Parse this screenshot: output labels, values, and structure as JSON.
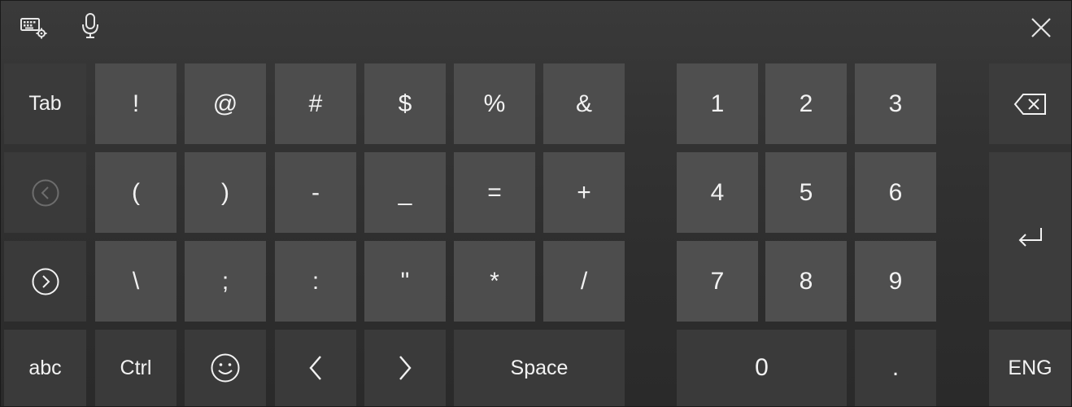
{
  "toolbar": {
    "settings_icon": "keyboard-settings-icon",
    "mic_icon": "microphone-icon",
    "close_icon": "close-icon"
  },
  "left_column": {
    "tab_label": "Tab",
    "back_icon": "circle-chevron-left-icon",
    "forward_icon": "circle-chevron-right-icon",
    "abc_label": "abc"
  },
  "symbols": {
    "row1": [
      "!",
      "@",
      "#",
      "$",
      "%",
      "&"
    ],
    "row2": [
      "(",
      ")",
      "-",
      "_",
      "=",
      "+"
    ],
    "row3": [
      "\\",
      ";",
      ":",
      "\"",
      "*",
      "/"
    ]
  },
  "bottom_row": {
    "ctrl_label": "Ctrl",
    "emoji_icon": "smiley-icon",
    "left_arrow_icon": "angle-left-icon",
    "right_arrow_icon": "angle-right-icon",
    "space_label": "Space"
  },
  "numpad": {
    "row1": [
      "1",
      "2",
      "3"
    ],
    "row2": [
      "4",
      "5",
      "6"
    ],
    "row3": [
      "7",
      "8",
      "9"
    ],
    "zero": "0",
    "dot": "."
  },
  "right_column": {
    "backspace_icon": "backspace-icon",
    "enter_icon": "enter-icon",
    "lang_label": "ENG"
  },
  "colors": {
    "key_face": "#4d4d4d",
    "function_key": "#3a3a3a",
    "background": "#2d2d2d",
    "text": "#f2f2f2"
  }
}
